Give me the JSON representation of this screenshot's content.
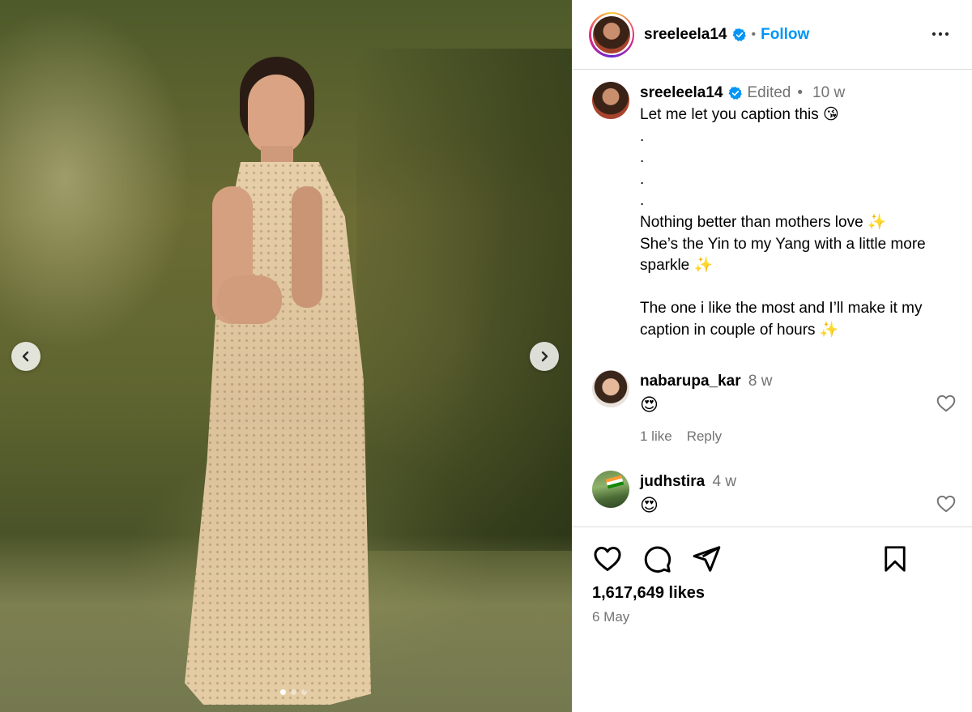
{
  "post": {
    "username": "sreeleela14",
    "follow_label": "Follow",
    "separator": "•",
    "more_icon": "more-horizontal-icon",
    "verified_icon": "verified-badge-icon"
  },
  "caption": {
    "username": "sreeleela14",
    "edited": "Edited",
    "age": "10 w",
    "text": "Let me let you caption this 😘\n.\n.\n.\n.\nNothing better than mothers love ✨\nShe’s the Yin to my Yang with a little more sparkle ✨\n\nThe one i like the most and I’ll make it my caption in couple of hours ✨"
  },
  "comments": [
    {
      "username": "nabarupa_kar",
      "age": "8 w",
      "text": "😍",
      "likes": "1 like",
      "reply": "Reply"
    },
    {
      "username": "judhstira",
      "age": "4 w",
      "text": "😍"
    }
  ],
  "actions": {
    "likes": "1,617,649 likes",
    "date": "6 May"
  },
  "carousel": {
    "slides": 3,
    "current": 1
  },
  "colors": {
    "accent": "#0095f6",
    "muted": "#737373",
    "divider": "#dbdbdb"
  }
}
